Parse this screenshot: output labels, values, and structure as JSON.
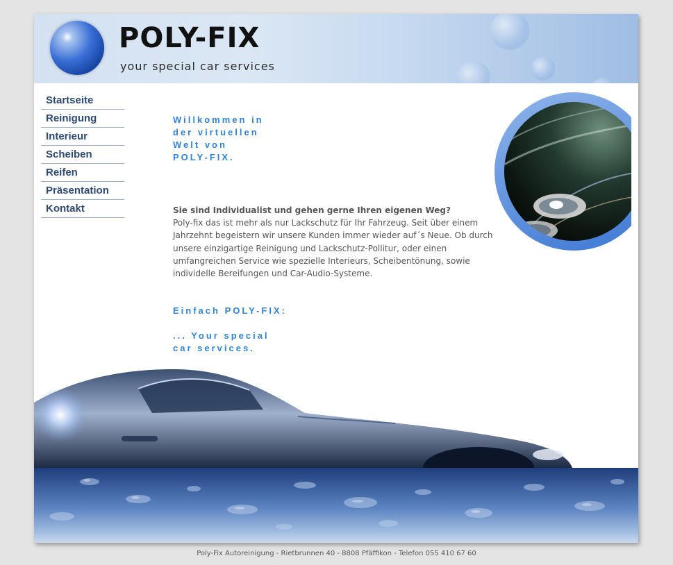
{
  "header": {
    "brand_name": "POLY-FIX",
    "tagline": "your special car services"
  },
  "nav": {
    "items": [
      {
        "label": "Startseite"
      },
      {
        "label": "Reinigung"
      },
      {
        "label": "Interieur"
      },
      {
        "label": "Scheiben"
      },
      {
        "label": "Reifen"
      },
      {
        "label": "Präsentation"
      },
      {
        "label": "Kontakt"
      }
    ]
  },
  "content": {
    "welcome_lines": [
      "Willkommen in",
      "der virtuellen",
      "Welt von",
      "POLY-FIX."
    ],
    "intro_heading": "Sie sind Individualist und gehen gerne Ihren eigenen Weg?",
    "intro_body": "Poly-fix das ist mehr als nur Lackschutz für Ihr Fahrzeug. Seit über einem Jahrzehnt begeistern wir unsere Kunden immer wieder auf´s Neue. Ob durch unsere einzigartige Reinigung und Lackschutz-Pollitur, oder einen umfangreichen Service wie spezielle Interieurs, Scheibentönung, sowie individelle Bereifungen und Car-Audio-Systeme.",
    "slogan": "Einfach POLY-FIX:",
    "slogan_lines": [
      "... Your special",
      "car services."
    ]
  },
  "footer": {
    "text": "Poly-Fix Autoreinigung - Rietbrunnen 40 - 8808 Pfäffikon - Telefon 055 410 67 60"
  },
  "colors": {
    "accent": "#2e84d8",
    "nav_text": "#2c4a74",
    "body_text": "#555555",
    "background": "#e4e4e4"
  }
}
